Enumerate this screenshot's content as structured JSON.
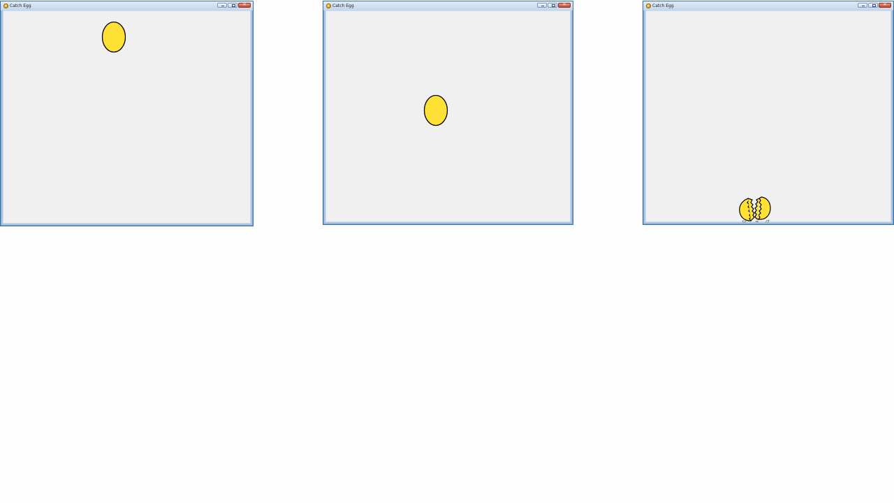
{
  "windows": [
    {
      "title": "Catch Egg",
      "state": "falling",
      "egg_color": "#ffe035"
    },
    {
      "title": "Catch Egg",
      "state": "falling",
      "egg_color": "#ffe035"
    },
    {
      "title": "Catch Egg",
      "state": "broken",
      "egg_color": "#ffe035"
    }
  ],
  "icons": {
    "app": "egg-app-icon",
    "minimize": "minimize-icon",
    "maximize": "maximize-icon",
    "close": "close-icon"
  },
  "colors": {
    "egg_fill": "#ffe035",
    "egg_outline": "#000000",
    "client_bg": "#f0f0f0",
    "frame": "#3a6ea5"
  }
}
